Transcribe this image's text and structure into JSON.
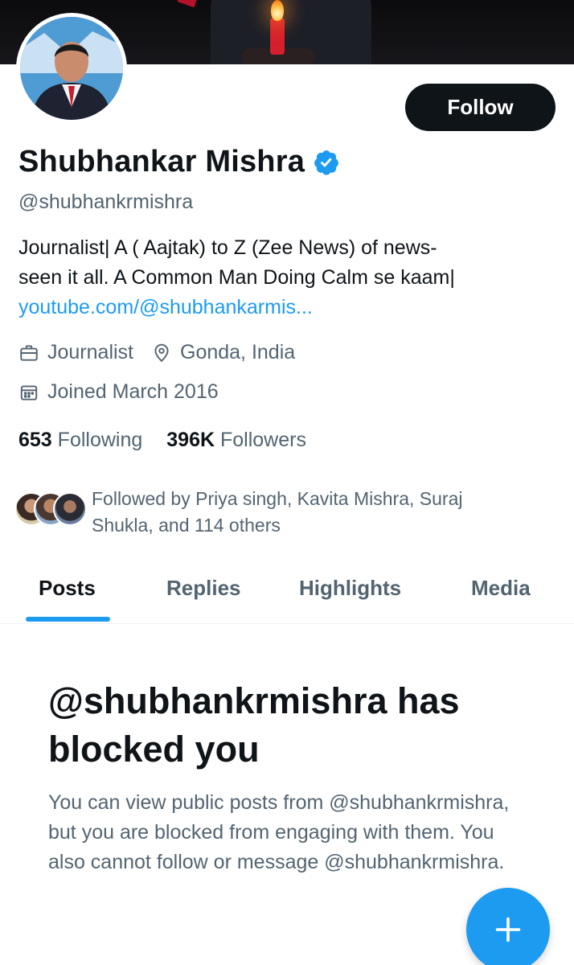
{
  "profile": {
    "name": "Shubhankar Mishra",
    "handle": "@shubhankrmishra",
    "verified_icon": "verified-badge-icon",
    "bio_line1": "Journalist| A ( Aajtak) to Z (Zee News) of news-",
    "bio_line2": "seen it all. A Common Man Doing Calm se kaam|",
    "bio_link": "youtube.com/@shubhankarmis...",
    "profession": "Journalist",
    "location": "Gonda, India",
    "joined": "Joined March 2016"
  },
  "actions": {
    "follow_label": "Follow"
  },
  "stats": {
    "following_count": "653",
    "following_label": "Following",
    "followers_count": "396K",
    "followers_label": "Followers"
  },
  "followed_by": {
    "text": "Followed by Priya singh, Kavita Mishra, Suraj Shukla, and 114 others"
  },
  "tabs": [
    {
      "label": "Posts",
      "active": true
    },
    {
      "label": "Replies",
      "active": false
    },
    {
      "label": "Highlights",
      "active": false
    },
    {
      "label": "Media",
      "active": false
    }
  ],
  "blocked": {
    "title": "@shubhankrmishra has blocked you",
    "description": "You can view public posts from @shubhankrmishra, but you are blocked from engaging with them. You also cannot follow or message @shubhankrmishra."
  },
  "fab": {
    "icon": "plus-icon"
  },
  "colors": {
    "accent": "#1d9bf0",
    "text_primary": "#0f1419",
    "text_secondary": "#536471",
    "follow_button": "#0f1419"
  }
}
